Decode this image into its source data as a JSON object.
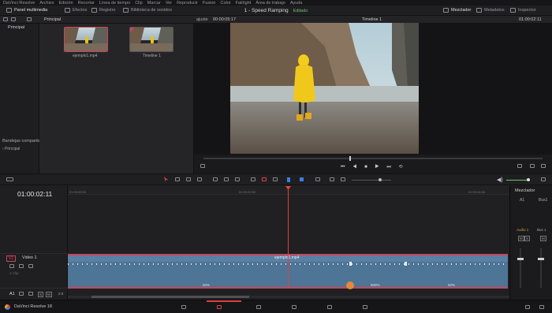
{
  "menu": [
    "DaVinci Resolve",
    "Archivo",
    "Edición",
    "Recortar",
    "Línea de tiempo",
    "Clip",
    "Marcar",
    "Ver",
    "Reproducir",
    "Fusion",
    "Color",
    "Fairlight",
    "Área de trabajo",
    "Ayuda"
  ],
  "toolbar": {
    "media_pool": "Panel multimedia",
    "effects": "Efectos",
    "index": "Registro",
    "sound_library": "Biblioteca de sonidos",
    "mixer": "Mezclador",
    "metadata": "Metadatos",
    "inspector": "Inspector"
  },
  "project": {
    "title": "1 - Speed Ramping",
    "status": "Editado"
  },
  "subbar": {
    "bin_label": "Principal",
    "zoom": "ajuste",
    "source_tc": "00:00:05:17",
    "timeline_name": "Timeline 1",
    "record_tc": "01:00:02:11"
  },
  "bins": {
    "master": "Principal",
    "shared": "Bandejas compartidas",
    "shared_item": "Principal"
  },
  "media": [
    {
      "name": "ejemplo1.mp4"
    },
    {
      "name": "Timeline 1"
    }
  ],
  "timeline": {
    "timecode": "01:00:02:11",
    "ruler": [
      "01:00:00:00",
      "01:00:02:00",
      "01:00:04:00"
    ],
    "video_track": {
      "id": "V1",
      "name": "Video 1",
      "sub": "1 Clip"
    },
    "audio_track": {
      "id": "A1",
      "level": "2.0"
    },
    "clip_name": "ejemplo1.mp4",
    "speeds": [
      "50%",
      "800%",
      "50%"
    ]
  },
  "mixer": {
    "title": "Mezclador",
    "a1": "A1",
    "bus1": "Bus1",
    "audio1": "Audio 1",
    "bus1b": "Bus 1",
    "buttons": [
      "M",
      "S",
      "M"
    ]
  },
  "bottom": {
    "app": "DaVinci Resolve 18"
  },
  "colors": {
    "accent": "#c9455a",
    "clip": "#4e7496",
    "playhead": "#e04040",
    "edited": "#71c16a"
  }
}
